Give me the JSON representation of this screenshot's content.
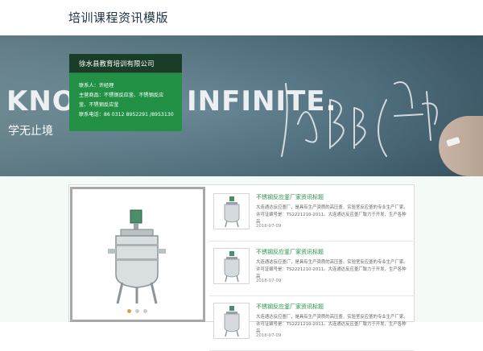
{
  "header": {
    "site_title": "培训课程资讯模版"
  },
  "banner": {
    "chalk_left": "KNOW",
    "chalk_right": "INFINITE.",
    "tagline": "学无止境"
  },
  "company_card": {
    "name": "徐水县教育培训有限公司",
    "contact": "联系人：许经理",
    "products_line1": "主营商品：不锈钢反应釜、不锈钢反应",
    "products_line2": "釜、不锈钢反应釜",
    "phone": "联系电话：86 0312 8952291 /8953130"
  },
  "slider": {
    "dots": 3,
    "active_dot": 0
  },
  "news": [
    {
      "title": "不锈钢反应釜厂家资讯标题",
      "desc": "大连通达反应釜厂，是具有生产资质的高压釜、实验室反应釜的专业生产厂家。许可证编号是：TS2221210-2011。大连通达反应釜厂致力于开发、生产各种高",
      "date": "2018-07-09"
    },
    {
      "title": "不锈钢反应釜厂家资讯标题",
      "desc": "大连通达反应釜厂，是具有生产资质的高压釜、实验室反应釜的专业生产厂家。许可证编号是：TS2221210-2011。大连通达反应釜厂致力于开发、生产各种高",
      "date": "2018-07-09"
    },
    {
      "title": "不锈钢反应釜厂家资讯标题",
      "desc": "大连通达反应釜厂，是具有生产资质的高压釜、实验室反应釜的专业生产厂家。许可证编号是：TS2221210-2011。大连通达反应釜厂致力于开发、生产各种高",
      "date": "2018-07-09"
    }
  ],
  "colors": {
    "accent_green": "#239145",
    "card_dark": "#1a3d28",
    "title_navy": "#1d3147"
  }
}
